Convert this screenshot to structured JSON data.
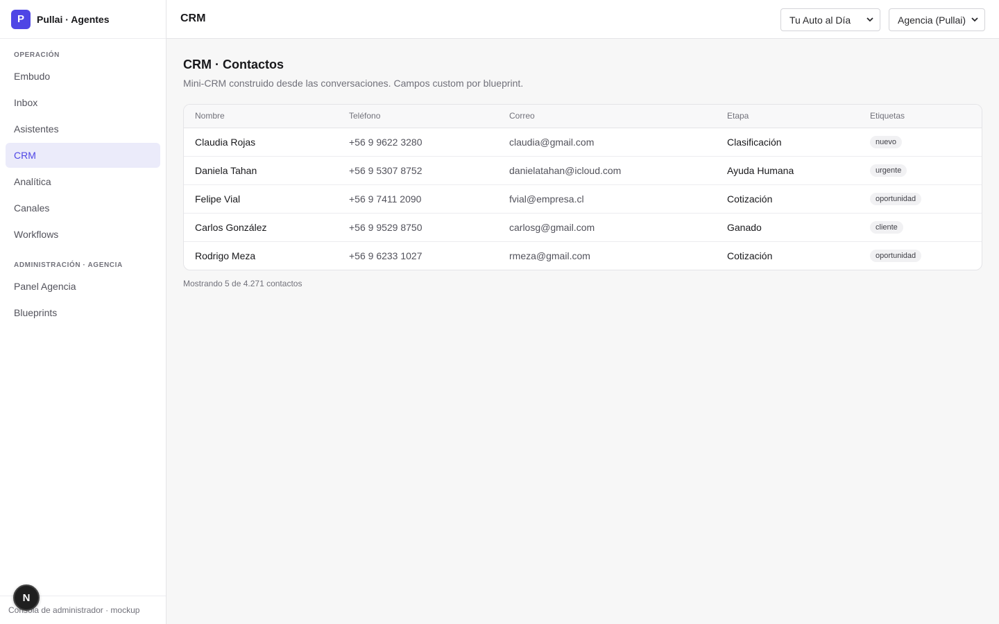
{
  "app": {
    "logo_letter": "P",
    "name": "Pullai · Agentes",
    "footer": "Consola de administrador · mockup",
    "overlay_badge": "N"
  },
  "sidebar": {
    "section1_label": "Operación",
    "section1_items": [
      {
        "label": "Embudo",
        "active": false
      },
      {
        "label": "Inbox",
        "active": false
      },
      {
        "label": "Asistentes",
        "active": false
      },
      {
        "label": "CRM",
        "active": true
      },
      {
        "label": "Analítica",
        "active": false
      },
      {
        "label": "Canales",
        "active": false
      },
      {
        "label": "Workflows",
        "active": false
      }
    ],
    "section2_label": "Administración · Agencia",
    "section2_items": [
      {
        "label": "Panel Agencia",
        "active": false
      },
      {
        "label": "Blueprints",
        "active": false
      }
    ]
  },
  "topbar": {
    "title": "CRM",
    "client_select": "Tu Auto al Día",
    "agency_select": "Agencia (Pullai)"
  },
  "page": {
    "title": "CRM · Contactos",
    "subtitle": "Mini-CRM construido desde las conversaciones. Campos custom por blueprint.",
    "showing": "Mostrando 5 de 4.271 contactos"
  },
  "table": {
    "headers": [
      "Nombre",
      "Teléfono",
      "Correo",
      "Etapa",
      "Etiquetas"
    ],
    "rows": [
      {
        "name": "Claudia Rojas",
        "phone": "+56 9 9622 3280",
        "email": "claudia@gmail.com",
        "stage": "Clasificación",
        "tag": "nuevo"
      },
      {
        "name": "Daniela Tahan",
        "phone": "+56 9 5307 8752",
        "email": "danielatahan@icloud.com",
        "stage": "Ayuda Humana",
        "tag": "urgente"
      },
      {
        "name": "Felipe Vial",
        "phone": "+56 9 7411 2090",
        "email": "fvial@empresa.cl",
        "stage": "Cotización",
        "tag": "oportunidad"
      },
      {
        "name": "Carlos González",
        "phone": "+56 9 9529 8750",
        "email": "carlosg@gmail.com",
        "stage": "Ganado",
        "tag": "cliente"
      },
      {
        "name": "Rodrigo Meza",
        "phone": "+56 9 6233 1027",
        "email": "rmeza@gmail.com",
        "stage": "Cotización",
        "tag": "oportunidad"
      }
    ]
  },
  "colors": {
    "accent": "#4f46e5",
    "active_bg": "#ebebfa"
  }
}
